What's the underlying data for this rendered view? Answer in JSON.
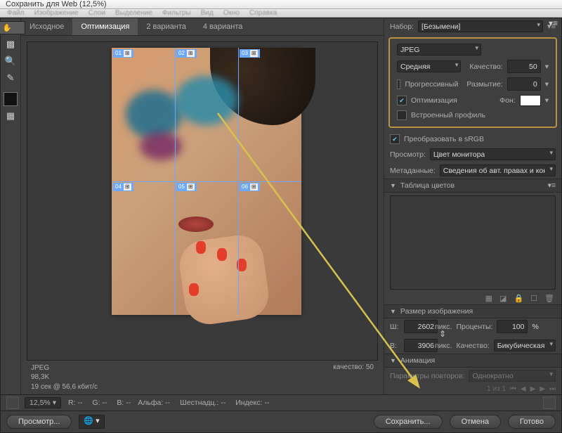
{
  "window": {
    "title": "Сохранить для Web (12,5%)"
  },
  "menubar": [
    "Файл",
    "Изображение",
    "Слои",
    "Выделение",
    "Фильтры",
    "Вид",
    "Окно",
    "Справка"
  ],
  "tabs": {
    "items": [
      "Исходное",
      "Оптимизация",
      "2 варианта",
      "4 варианта"
    ],
    "active_index": 1
  },
  "slices": [
    "01",
    "02",
    "03",
    "04",
    "05",
    "06"
  ],
  "canvas": {
    "format_line": "JPEG",
    "size_line": "98,3K",
    "time_line": "19 сек @ 56,6 кбит/с",
    "quality_label": "качество: 50"
  },
  "right": {
    "preset_label": "Набор:",
    "preset_value": "[Безымени]",
    "format": "JPEG",
    "quality_preset": "Средняя",
    "quality_label": "Качество:",
    "quality_value": "50",
    "progressive_label": "Прогрессивный",
    "progressive_on": false,
    "blur_label": "Размытие:",
    "blur_value": "0",
    "optimized_label": "Оптимизация",
    "optimized_on": true,
    "matte_label": "Фон:",
    "embed_label": "Встроенный профиль",
    "embed_on": false,
    "srgb_label": "Преобразовать в sRGB",
    "srgb_on": true,
    "preview_label": "Просмотр:",
    "preview_value": "Цвет монитора",
    "metadata_label": "Метаданные:",
    "metadata_value": "Сведения об авт. правах и контакты",
    "color_table_label": "Таблица цветов",
    "image_size_label": "Размер изображения",
    "w_label": "Ш:",
    "w_value": "2602",
    "h_label": "В:",
    "h_value": "3906",
    "px_label": "пикс.",
    "percent_label": "Проценты:",
    "percent_value": "100",
    "percent_sign": "%",
    "resample_label": "Качество:",
    "resample_value": "Бикубическая",
    "anim_label": "Анимация",
    "loop_label": "Параметры повторов:",
    "loop_value": "Однократно",
    "frame_counter": "1 из 1"
  },
  "statusbar": {
    "zoom": "12,5%",
    "r": "R: --",
    "g": "G: --",
    "b": "B: --",
    "alpha": "Альфа: --",
    "hex": "Шестнадц.: --",
    "index": "Индекс: --"
  },
  "buttons": {
    "preview": "Просмотр...",
    "save": "Сохранить...",
    "cancel": "Отмена",
    "done": "Готово"
  }
}
